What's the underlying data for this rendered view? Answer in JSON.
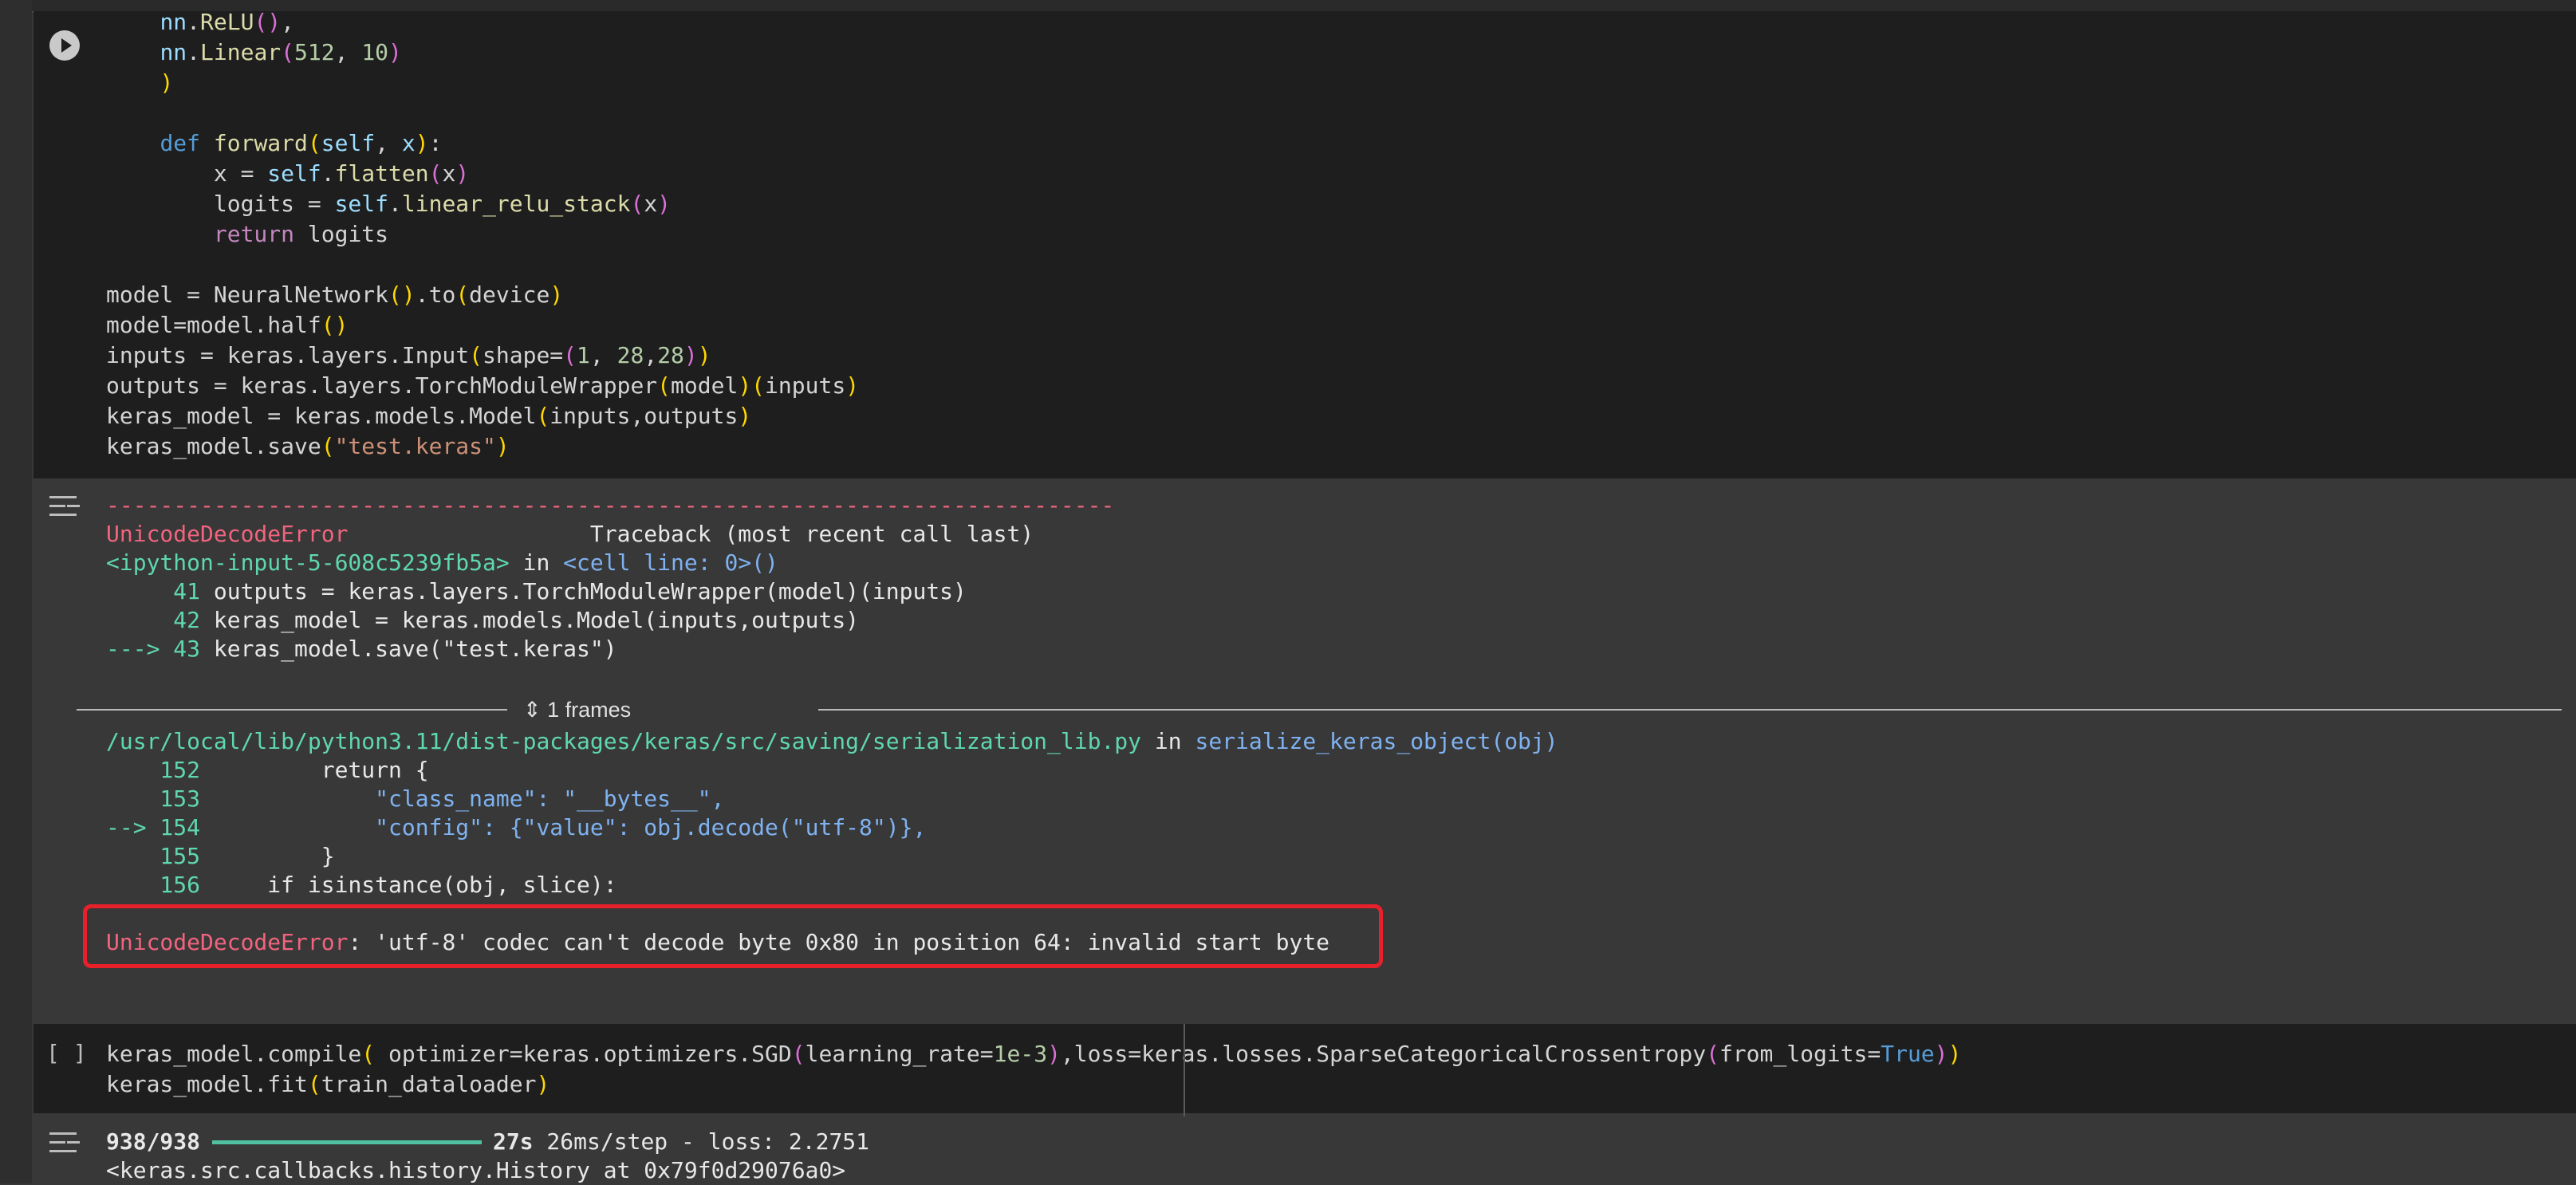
{
  "code_cell": {
    "lines": [
      "        nn.ReLU(),",
      "        nn.Linear(512, 10)",
      "    )",
      "",
      "def forward(self, x):",
      "    x = self.flatten(x)",
      "    logits = self.linear_relu_stack(x)",
      "    return logits",
      "",
      "model = NeuralNetwork().to(device)",
      "model=model.half()",
      "inputs = keras.layers.Input(shape=(1, 28,28))",
      "outputs = keras.layers.TorchModuleWrapper(model)(inputs)",
      "keras_model = keras.models.Model(inputs,outputs)",
      "keras_model.save(\"test.keras\")"
    ]
  },
  "traceback": {
    "dash_line": "---------------------------------------------------------------------------",
    "error_name": "UnicodeDecodeError",
    "header_right": "Traceback (most recent call last)",
    "input_ref": "<ipython-input-5-608c5239fb5a>",
    "in_word": " in ",
    "cell_ref": "<cell line: 0>()",
    "ctx_lines": [
      {
        "num": "     41",
        "code": " outputs = keras.layers.TorchModuleWrapper(model)(inputs)"
      },
      {
        "num": "     42",
        "code": " keras_model = keras.models.Model(inputs,outputs)"
      },
      {
        "num": "---> 43",
        "code": " keras_model.save(\"test.keras\")"
      }
    ],
    "frames_label": "1 frames",
    "file_path": "/usr/local/lib/python3.11/dist-packages/keras/src/saving/serialization_lib.py",
    "func_ref": "serialize_keras_object(obj)",
    "src_lines": [
      {
        "num": "    152",
        "code": "         return {"
      },
      {
        "num": "    153",
        "code": "             \"class_name\": \"__bytes__\","
      },
      {
        "num": "--> 154",
        "code": "             \"config\": {\"value\": obj.decode(\"utf-8\")},"
      },
      {
        "num": "    155",
        "code": "         }"
      },
      {
        "num": "    156",
        "code": "     if isinstance(obj, slice):"
      }
    ],
    "final_error_name": "UnicodeDecodeError",
    "final_error_msg": ": 'utf-8' codec can't decode byte 0x80 in position 64: invalid start byte"
  },
  "code_cell2": {
    "bracket": "[ ]",
    "lines": [
      "keras_model.compile( optimizer=keras.optimizers.SGD(learning_rate=1e-3),loss=keras.losses.SparseCategoricalCrossentropy(from_logits=True))",
      "keras_model.fit(train_dataloader)"
    ]
  },
  "output2": {
    "step_count": "938/938",
    "progress": 1.0,
    "time": "27s",
    "rest": " 26ms/step - loss: 2.2751",
    "history": "<keras.src.callbacks.history.History at 0x79f0d29076a0>"
  },
  "colors": {
    "error": "#f2647e",
    "highlight_border": "#e8202a",
    "progress": "#4fc1a0"
  }
}
